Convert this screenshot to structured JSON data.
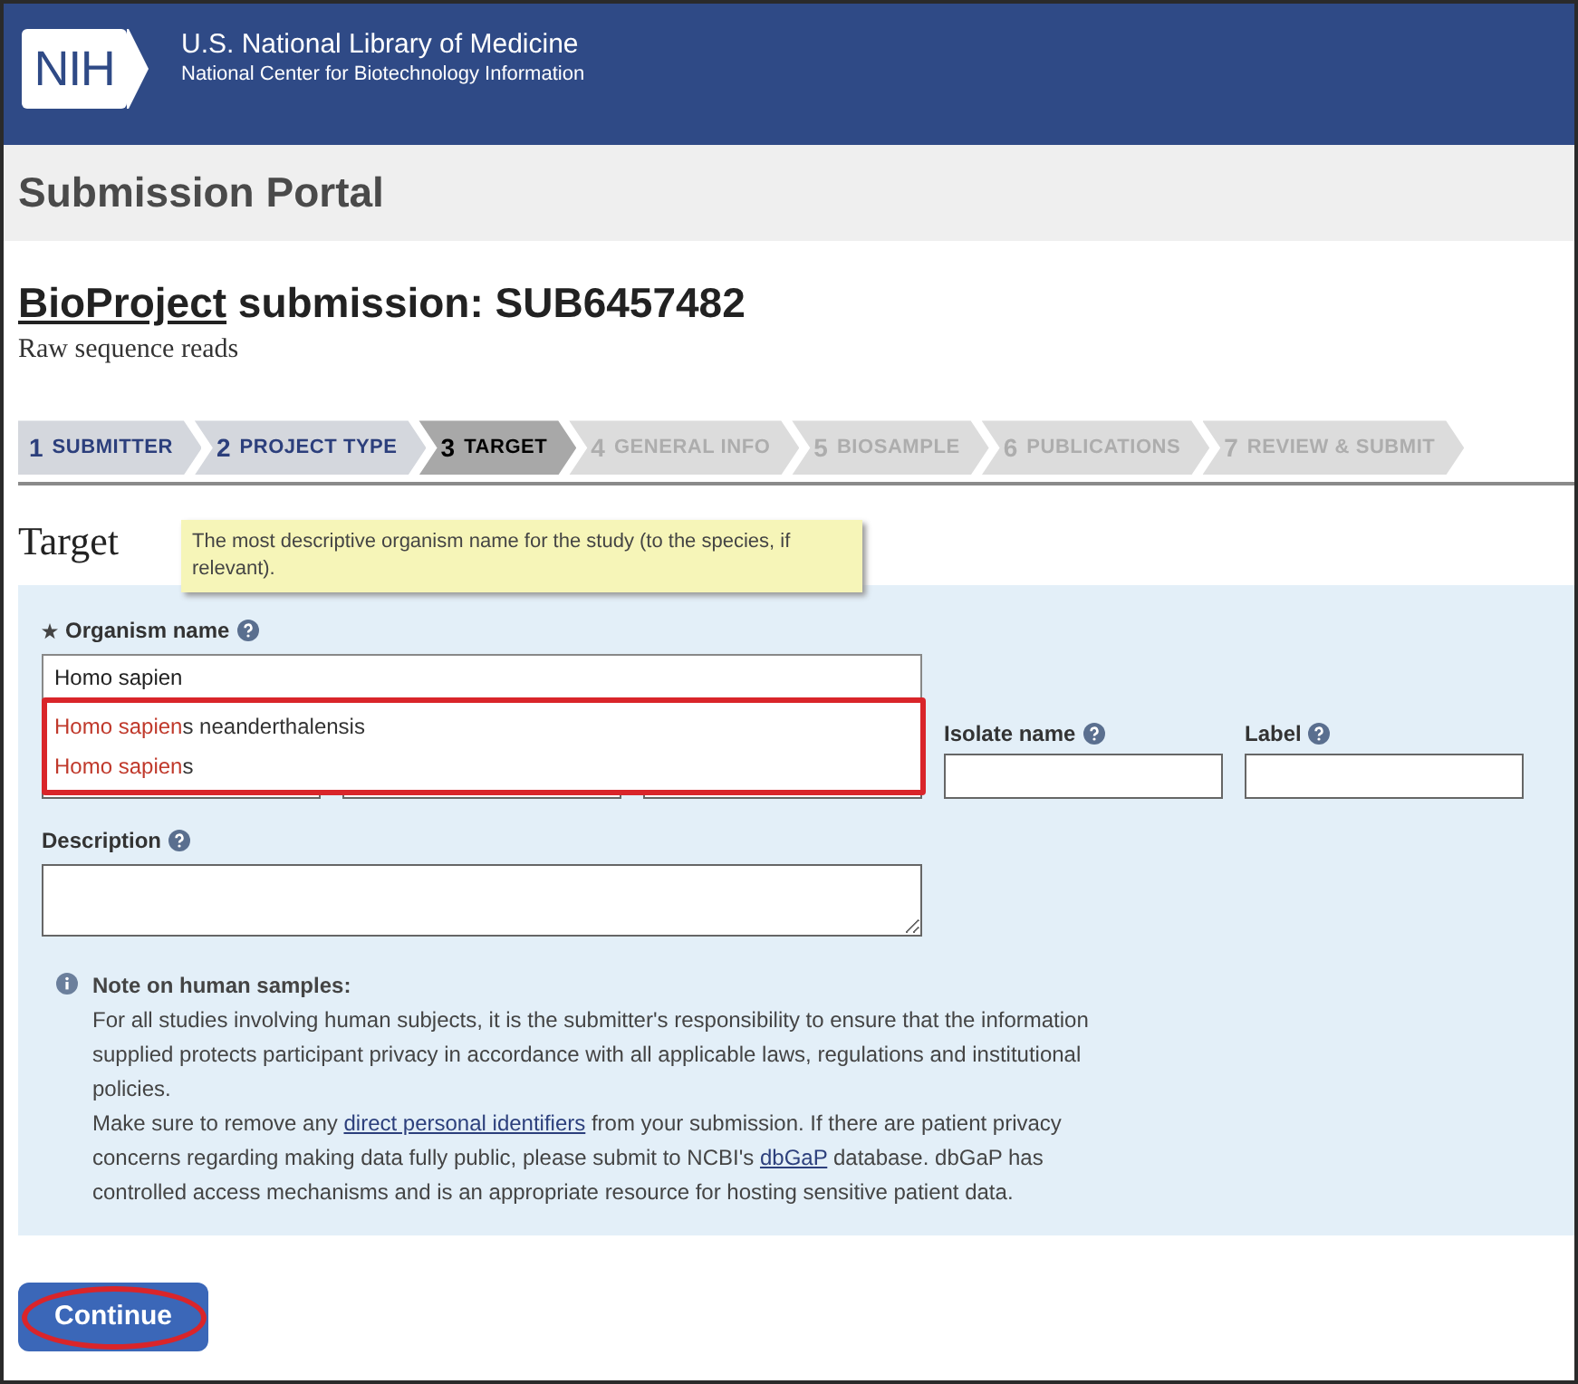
{
  "header": {
    "logo": "NIH",
    "title": "U.S. National Library of Medicine",
    "subtitle": "National Center for Biotechnology Information"
  },
  "portal_title": "Submission Portal",
  "submission": {
    "link": "BioProject",
    "title": " submission: SUB6457482",
    "subtitle": "Raw sequence reads"
  },
  "steps": [
    {
      "number": "1",
      "label": "SUBMITTER",
      "selected": false,
      "disabled": false
    },
    {
      "number": "2",
      "label": "PROJECT TYPE",
      "selected": false,
      "disabled": false
    },
    {
      "number": "3",
      "label": "TARGET",
      "selected": true,
      "disabled": false
    },
    {
      "number": "4",
      "label": "GENERAL INFO",
      "selected": false,
      "disabled": true
    },
    {
      "number": "5",
      "label": "BIOSAMPLE",
      "selected": false,
      "disabled": true
    },
    {
      "number": "6",
      "label": "PUBLICATIONS",
      "selected": false,
      "disabled": true
    },
    {
      "number": "7",
      "label": "REVIEW & SUBMIT",
      "selected": false,
      "disabled": true
    }
  ],
  "section_title": "Target",
  "tooltip": "The most descriptive organism name for the study (to the species, if relevant).",
  "organism": {
    "label": "Organism name",
    "required": true,
    "value": "Homo sapien"
  },
  "suggestions": [
    {
      "match": "Homo sapien",
      "rest": "s neanderthalensis"
    },
    {
      "match": "Homo sapien",
      "rest": "s"
    }
  ],
  "fields": [
    {
      "kind": "unlabeled"
    },
    {
      "kind": "unlabeled"
    },
    {
      "kind": "unlabeled"
    },
    {
      "kind": "labeled",
      "label": "Isolate name"
    },
    {
      "kind": "labeled",
      "label": "Label"
    }
  ],
  "description": {
    "label": "Description"
  },
  "note": {
    "title": "Note on human samples:",
    "paragraphs": [
      [
        {
          "text": "For all studies involving human subjects, it is the submitter's responsibility to ensure that the information supplied protects participant privacy in accordance with all applicable laws, regulations and institutional policies."
        }
      ],
      [
        {
          "text": "Make sure to remove any "
        },
        {
          "text": "direct personal identifiers",
          "link": true
        },
        {
          "text": " from your submission. If there are patient privacy concerns regarding making data fully public, please submit to NCBI's "
        },
        {
          "text": "dbGaP",
          "link": true
        },
        {
          "text": " database. dbGaP has controlled access mechanisms and is an appropriate resource for hosting sensitive patient data."
        }
      ]
    ]
  },
  "continue_button": {
    "label": "Continue",
    "highlighted": true
  }
}
